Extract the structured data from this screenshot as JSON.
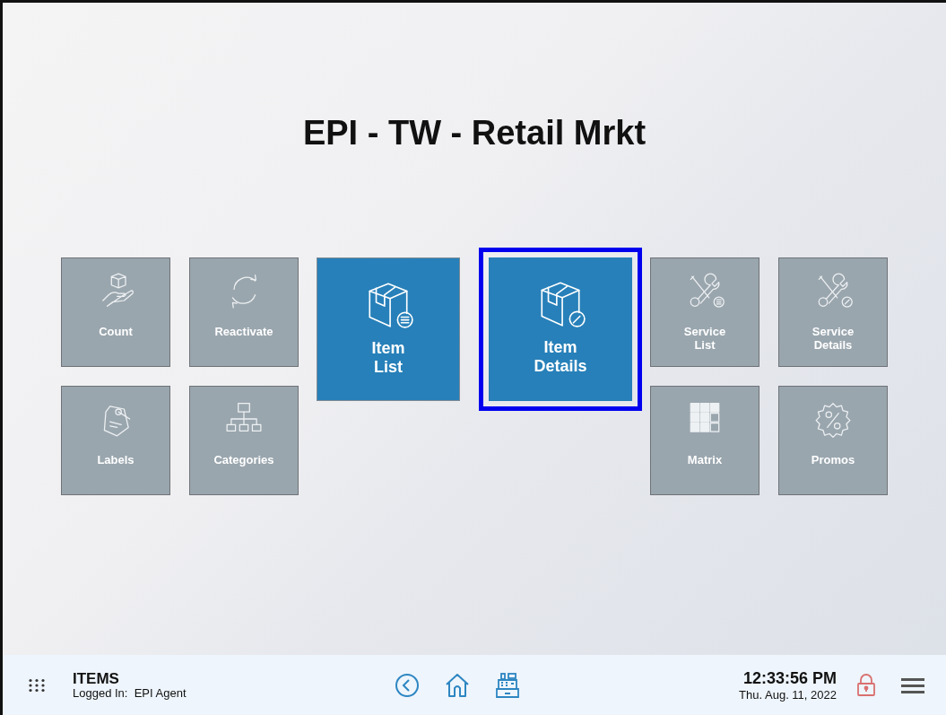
{
  "title": "EPI - TW - Retail Mrkt",
  "left_tiles": [
    {
      "label": "Count",
      "selected": false
    },
    {
      "label": "Reactivate",
      "selected": false
    },
    {
      "label": "Labels",
      "selected": false
    },
    {
      "label": "Categories",
      "selected": false
    }
  ],
  "center_tiles": [
    {
      "label": "Item\nList",
      "selected": false
    },
    {
      "label": "Item\nDetails",
      "selected": true
    }
  ],
  "right_tiles": [
    {
      "label": "Service\nList",
      "selected": false
    },
    {
      "label": "Service\nDetails",
      "selected": false
    },
    {
      "label": "Matrix",
      "selected": false
    },
    {
      "label": "Promos",
      "selected": false
    }
  ],
  "status_bar": {
    "module": "ITEMS",
    "logged_in": "Logged In:  EPI Agent",
    "time": "12:33:56 PM",
    "date": "Thu. Aug. 11, 2022"
  }
}
